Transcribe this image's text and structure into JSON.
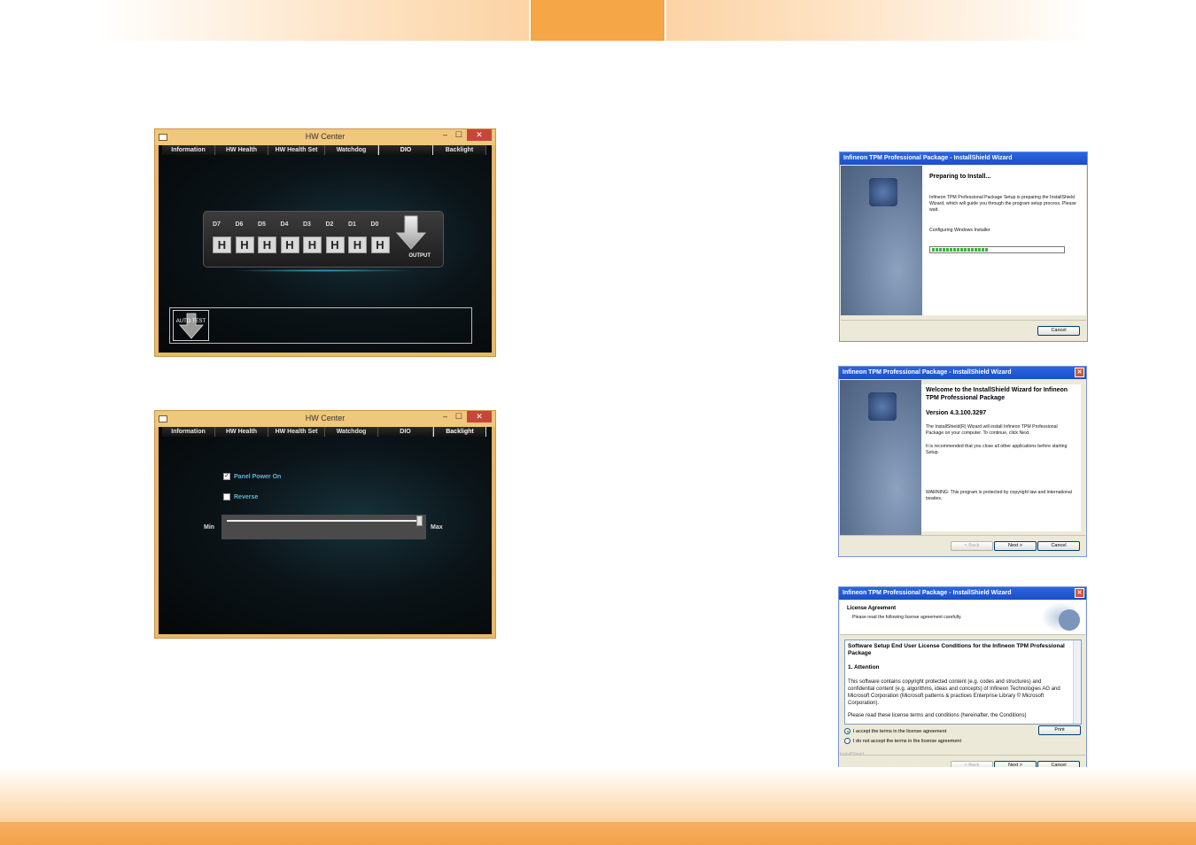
{
  "hw_center_dio": {
    "title": "HW Center",
    "min_glyph": "–",
    "max_glyph": "☐",
    "close_glyph": "✕",
    "tabs": [
      "Information",
      "HW Health",
      "HW Health Set",
      "Watchdog",
      "DIO",
      "Backlight"
    ],
    "active_tab": "DIO",
    "bit_labels": [
      "D7",
      "D6",
      "D5",
      "D4",
      "D3",
      "D2",
      "D1",
      "D0"
    ],
    "bit_values": [
      "H",
      "H",
      "H",
      "H",
      "H",
      "H",
      "H",
      "H"
    ],
    "output_label": "OUTPUT",
    "auto_test_label": "AUTO TEST"
  },
  "hw_center_backlight": {
    "title": "HW Center",
    "min_glyph": "–",
    "max_glyph": "☐",
    "close_glyph": "✕",
    "tabs": [
      "Information",
      "HW Health",
      "HW Health Set",
      "Watchdog",
      "DIO",
      "Backlight"
    ],
    "active_tab": "Backlight",
    "panel_power_label": "Panel Power On",
    "panel_power_checked": true,
    "reverse_label": "Reverse",
    "reverse_checked": false,
    "slider_min": "Min",
    "slider_max": "Max",
    "slider_level": 1.0
  },
  "wizard_preparing": {
    "title": "Infineon TPM Professional Package - InstallShield Wizard",
    "heading": "Preparing to Install...",
    "description": "Infineon TPM Professional Package Setup is preparing the InstallShield Wizard, which will guide you through the program setup process. Please wait.",
    "status": "Configuring Windows Installer",
    "progress": 0.42,
    "cancel_label": "Cancel"
  },
  "wizard_welcome": {
    "title": "Infineon TPM Professional Package - InstallShield Wizard",
    "heading": "Welcome to the InstallShield Wizard for Infineon TPM Professional Package",
    "version": "Version 4.3.100.3297",
    "para1": "The InstallShield(R) Wizard will install Infineon TPM Professional Package on your computer. To continue, click Next.",
    "para2": "It is recommended that you close all other applications before starting Setup.",
    "warning": "WARNING: This program is protected by copyright law and international treaties.",
    "back_label": "< Back",
    "next_label": "Next >",
    "cancel_label": "Cancel",
    "close_glyph": "✕"
  },
  "wizard_license": {
    "title": "Infineon TPM Professional Package - InstallShield Wizard",
    "heading": "License Agreement",
    "subheading": "Please read the following license agreement carefully.",
    "license_title": "Software Setup End User License Conditions for the Infineon TPM Professional Package",
    "section": "1. Attention",
    "body": "This software contains copyright protected content (e.g. codes and structures) and confidential content (e.g. algorithms, ideas and concepts) of Infineon Technologies AG and Microsoft Corporation (Microsoft patterns & practices Enterprise Library © Microsoft Corporation).",
    "body_cut": "Please read these license terms and conditions (hereinafter, the Conditions)",
    "accept_label": "I accept the terms in the license agreement",
    "decline_label": "I do not accept the terms in the license agreement",
    "print_label": "Print",
    "installshield_label": "InstallShield",
    "back_label": "< Back",
    "next_label": "Next >",
    "cancel_label": "Cancel",
    "close_glyph": "✕"
  }
}
